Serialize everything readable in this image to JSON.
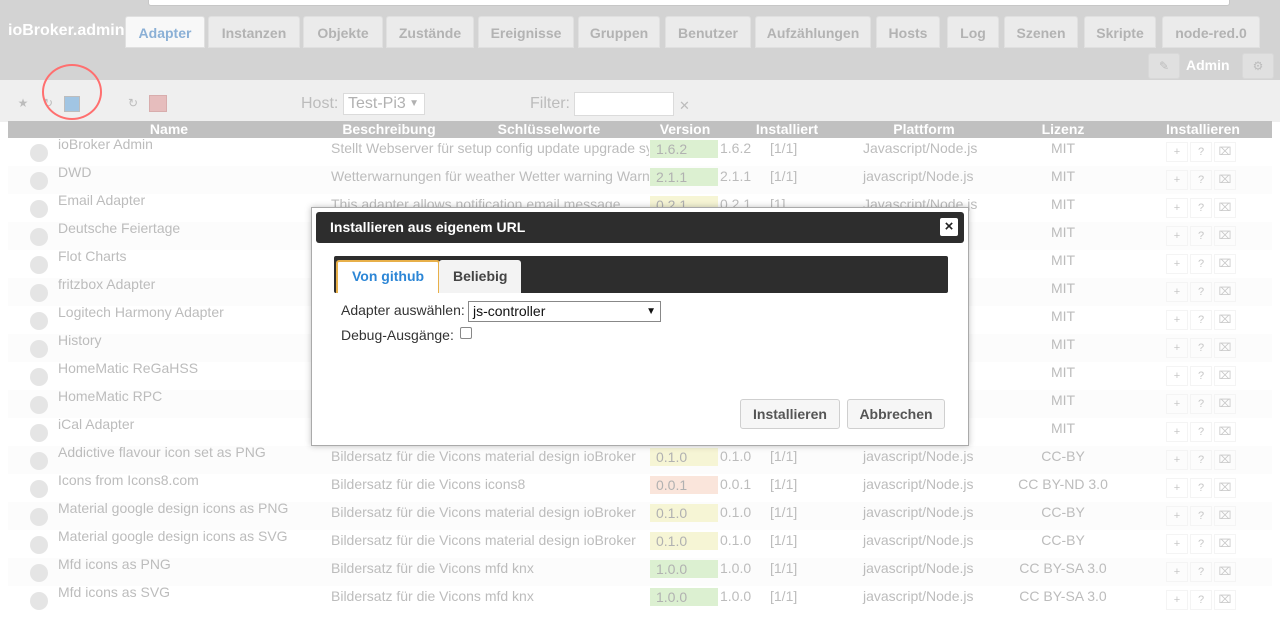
{
  "app": {
    "brand": "ioBroker.admin"
  },
  "tabs": [
    "Adapter",
    "Instanzen",
    "Objekte",
    "Zustände",
    "Ereignisse",
    "Gruppen",
    "Benutzer",
    "Aufzählungen",
    "Hosts",
    "Log",
    "Szenen",
    "Skripte",
    "node-red.0"
  ],
  "header": {
    "admin_label": "Admin"
  },
  "toolbar": {
    "host_label": "Host:",
    "host_value": "Test-Pi3",
    "filter_label": "Filter:",
    "filter_value": ""
  },
  "table": {
    "columns": [
      "Name",
      "Beschreibung",
      "Schlüsselworte",
      "Version",
      "Installiert",
      "Plattform",
      "Lizenz",
      "Installieren"
    ],
    "rows": [
      {
        "name": "ioBroker Admin",
        "desc": "Stellt Webserver für setup config update upgrade sys",
        "version": "1.6.2",
        "installed": "1.6.2",
        "count": "[1/1]",
        "platform": "Javascript/Node.js",
        "license": "MIT",
        "vc": "g"
      },
      {
        "name": "DWD",
        "desc": "Wetterwarnungen für weather Wetter warning Warnun",
        "version": "2.1.1",
        "installed": "2.1.1",
        "count": "[1/1]",
        "platform": "javascript/Node.js",
        "license": "MIT",
        "vc": "g"
      },
      {
        "name": "Email Adapter",
        "desc": "This adapter allows notification email message",
        "version": "0.2.1",
        "installed": "0.2.1",
        "count": "[1]",
        "platform": "Javascript/Node.js",
        "license": "MIT",
        "vc": "y"
      },
      {
        "name": "Deutsche Feiertage",
        "desc": "",
        "version": "",
        "installed": "",
        "count": "",
        "platform": "",
        "license": "MIT",
        "vc": "y"
      },
      {
        "name": "Flot Charts",
        "desc": "",
        "version": "",
        "installed": "",
        "count": "",
        "platform": "",
        "license": "MIT",
        "vc": "y"
      },
      {
        "name": "fritzbox Adapter",
        "desc": "",
        "version": "",
        "installed": "",
        "count": "",
        "platform": "",
        "license": "MIT",
        "vc": "y"
      },
      {
        "name": "Logitech Harmony Adapter",
        "desc": "",
        "version": "",
        "installed": "",
        "count": "",
        "platform": "",
        "license": "MIT",
        "vc": "y"
      },
      {
        "name": "History",
        "desc": "",
        "version": "",
        "installed": "",
        "count": "",
        "platform": "",
        "license": "MIT",
        "vc": "y"
      },
      {
        "name": "HomeMatic ReGaHSS",
        "desc": "",
        "version": "",
        "installed": "",
        "count": "",
        "platform": "",
        "license": "MIT",
        "vc": "y"
      },
      {
        "name": "HomeMatic RPC",
        "desc": "",
        "version": "",
        "installed": "",
        "count": "",
        "platform": "",
        "license": "MIT",
        "vc": "y"
      },
      {
        "name": "iCal Adapter",
        "desc": "",
        "version": "",
        "installed": "",
        "count": "",
        "platform": "",
        "license": "MIT",
        "vc": "y"
      },
      {
        "name": "Addictive flavour icon set as PNG",
        "desc": "Bildersatz für die Vicons material design ioBroker",
        "version": "0.1.0",
        "installed": "0.1.0",
        "count": "[1/1]",
        "platform": "javascript/Node.js",
        "license": "CC-BY",
        "vc": "y"
      },
      {
        "name": "Icons from Icons8.com",
        "desc": "Bildersatz für die Vicons icons8",
        "version": "0.0.1",
        "installed": "0.0.1",
        "count": "[1/1]",
        "platform": "javascript/Node.js",
        "license": "CC BY-ND 3.0",
        "vc": "o"
      },
      {
        "name": "Material google design icons as PNG",
        "desc": "Bildersatz für die Vicons material design ioBroker",
        "version": "0.1.0",
        "installed": "0.1.0",
        "count": "[1/1]",
        "platform": "javascript/Node.js",
        "license": "CC-BY",
        "vc": "y"
      },
      {
        "name": "Material google design icons as SVG",
        "desc": "Bildersatz für die Vicons material design ioBroker",
        "version": "0.1.0",
        "installed": "0.1.0",
        "count": "[1/1]",
        "platform": "javascript/Node.js",
        "license": "CC-BY",
        "vc": "y"
      },
      {
        "name": "Mfd icons as PNG",
        "desc": "Bildersatz für die Vicons mfd knx",
        "version": "1.0.0",
        "installed": "1.0.0",
        "count": "[1/1]",
        "platform": "javascript/Node.js",
        "license": "CC BY-SA 3.0",
        "vc": "g"
      },
      {
        "name": "Mfd icons as SVG",
        "desc": "Bildersatz für die Vicons mfd knx",
        "version": "1.0.0",
        "installed": "1.0.0",
        "count": "[1/1]",
        "platform": "javascript/Node.js",
        "license": "CC BY-SA 3.0",
        "vc": "g"
      }
    ]
  },
  "dialog": {
    "title": "Installieren aus eigenem URL",
    "close": "×",
    "tab_github": "Von github",
    "tab_any": "Beliebig",
    "adapter_label": "Adapter auswählen:",
    "adapter_value": "js-controller",
    "debug_label": "Debug-Ausgänge:",
    "install_button": "Installieren",
    "cancel_button": "Abbrechen"
  }
}
